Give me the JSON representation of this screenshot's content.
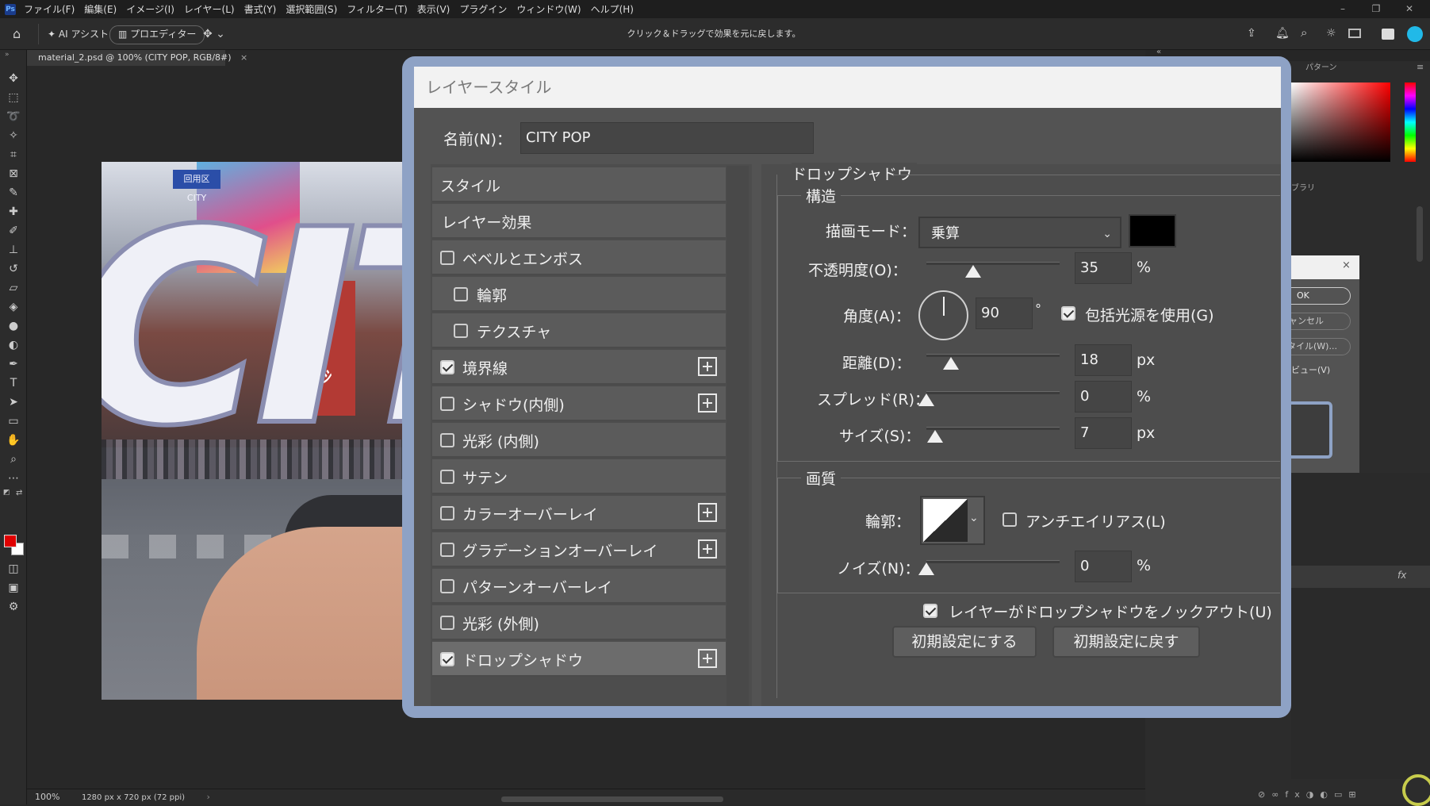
{
  "app": {
    "logo": "Ps",
    "menus": [
      "ファイル(F)",
      "編集(E)",
      "イメージ(I)",
      "レイヤー(L)",
      "書式(Y)",
      "選択範囲(S)",
      "フィルター(T)",
      "表示(V)",
      "プラグイン",
      "ウィンドウ(W)",
      "ヘルプ(H)"
    ]
  },
  "optionsbar": {
    "ai_assist": "AI アシスト",
    "property_editor": "プロエディター",
    "hint": "クリック＆ドラッグで効果を元に戻します。"
  },
  "document": {
    "tab": "material_2.psd @ 100% (CITY POP, RGB/8#)",
    "canvas_text": "CIT",
    "sign_text": "ﾌｸｼ",
    "led_text": "回用区 CITY"
  },
  "status": {
    "zoom": "100%",
    "doc_size": "1280 px x 720 px (72 ppi)"
  },
  "right_panel": {
    "tab_pattern": "パターン",
    "library_label": "ブラリ",
    "ok": "OK",
    "cancel": "ャンセル",
    "new_style": "タイル(W)...",
    "preview": "ビュー(V)",
    "fx_label": "fx"
  },
  "dialog": {
    "title": "レイヤースタイル",
    "name_label": "名前(N)：",
    "name_value": "CITY POP",
    "styles": [
      {
        "label": "スタイル",
        "checkbox": false,
        "plus": false
      },
      {
        "label": "レイヤー効果",
        "checkbox": false,
        "plus": false
      },
      {
        "label": "ベベルとエンボス",
        "checkbox": true,
        "checked": false,
        "plus": false
      },
      {
        "label": "輪郭",
        "checkbox": true,
        "checked": false,
        "plus": false,
        "indent": true
      },
      {
        "label": "テクスチャ",
        "checkbox": true,
        "checked": false,
        "plus": false,
        "indent": true
      },
      {
        "label": "境界線",
        "checkbox": true,
        "checked": true,
        "plus": true
      },
      {
        "label": "シャドウ(内側)",
        "checkbox": true,
        "checked": false,
        "plus": true
      },
      {
        "label": "光彩 (内側)",
        "checkbox": true,
        "checked": false,
        "plus": false
      },
      {
        "label": "サテン",
        "checkbox": true,
        "checked": false,
        "plus": false
      },
      {
        "label": "カラーオーバーレイ",
        "checkbox": true,
        "checked": false,
        "plus": true
      },
      {
        "label": "グラデーションオーバーレイ",
        "checkbox": true,
        "checked": false,
        "plus": true
      },
      {
        "label": "パターンオーバーレイ",
        "checkbox": true,
        "checked": false,
        "plus": false
      },
      {
        "label": "光彩 (外側)",
        "checkbox": true,
        "checked": false,
        "plus": false
      },
      {
        "label": "ドロップシャドウ",
        "checkbox": true,
        "checked": true,
        "plus": true,
        "selected": true
      }
    ],
    "section_title": "ドロップシャドウ",
    "structure": {
      "title": "構造",
      "blend_mode_label": "描画モード：",
      "blend_mode_value": "乗算",
      "shadow_color": "#000000",
      "opacity_label": "不透明度(O)：",
      "opacity_value": "35",
      "opacity_unit": "%",
      "opacity_fraction": 0.35,
      "angle_label": "角度(A)：",
      "angle_value": "90",
      "angle_unit": "°",
      "global_light_label": "包括光源を使用(G)",
      "global_light_checked": true,
      "distance_label": "距離(D)：",
      "distance_value": "18",
      "distance_unit": "px",
      "spread_label": "スプレッド(R)：",
      "spread_value": "0",
      "spread_unit": "%",
      "size_label": "サイズ(S)：",
      "size_value": "7",
      "size_unit": "px"
    },
    "quality": {
      "title": "画質",
      "contour_label": "輪郭：",
      "antialias_label": "アンチエイリアス(L)",
      "antialias_checked": false,
      "noise_label": "ノイズ(N)：",
      "noise_value": "0",
      "noise_unit": "%"
    },
    "knockout_label": "レイヤーがドロップシャドウをノックアウト(U)",
    "knockout_checked": true,
    "btn_make_default": "初期設定にする",
    "btn_reset_default": "初期設定に戻す"
  },
  "colors": {
    "frame": "#8ea2c5",
    "foreground": "#e00000",
    "background": "#ffffff",
    "text_fill": "#eff0f7",
    "text_stroke": "#8a8db0"
  }
}
